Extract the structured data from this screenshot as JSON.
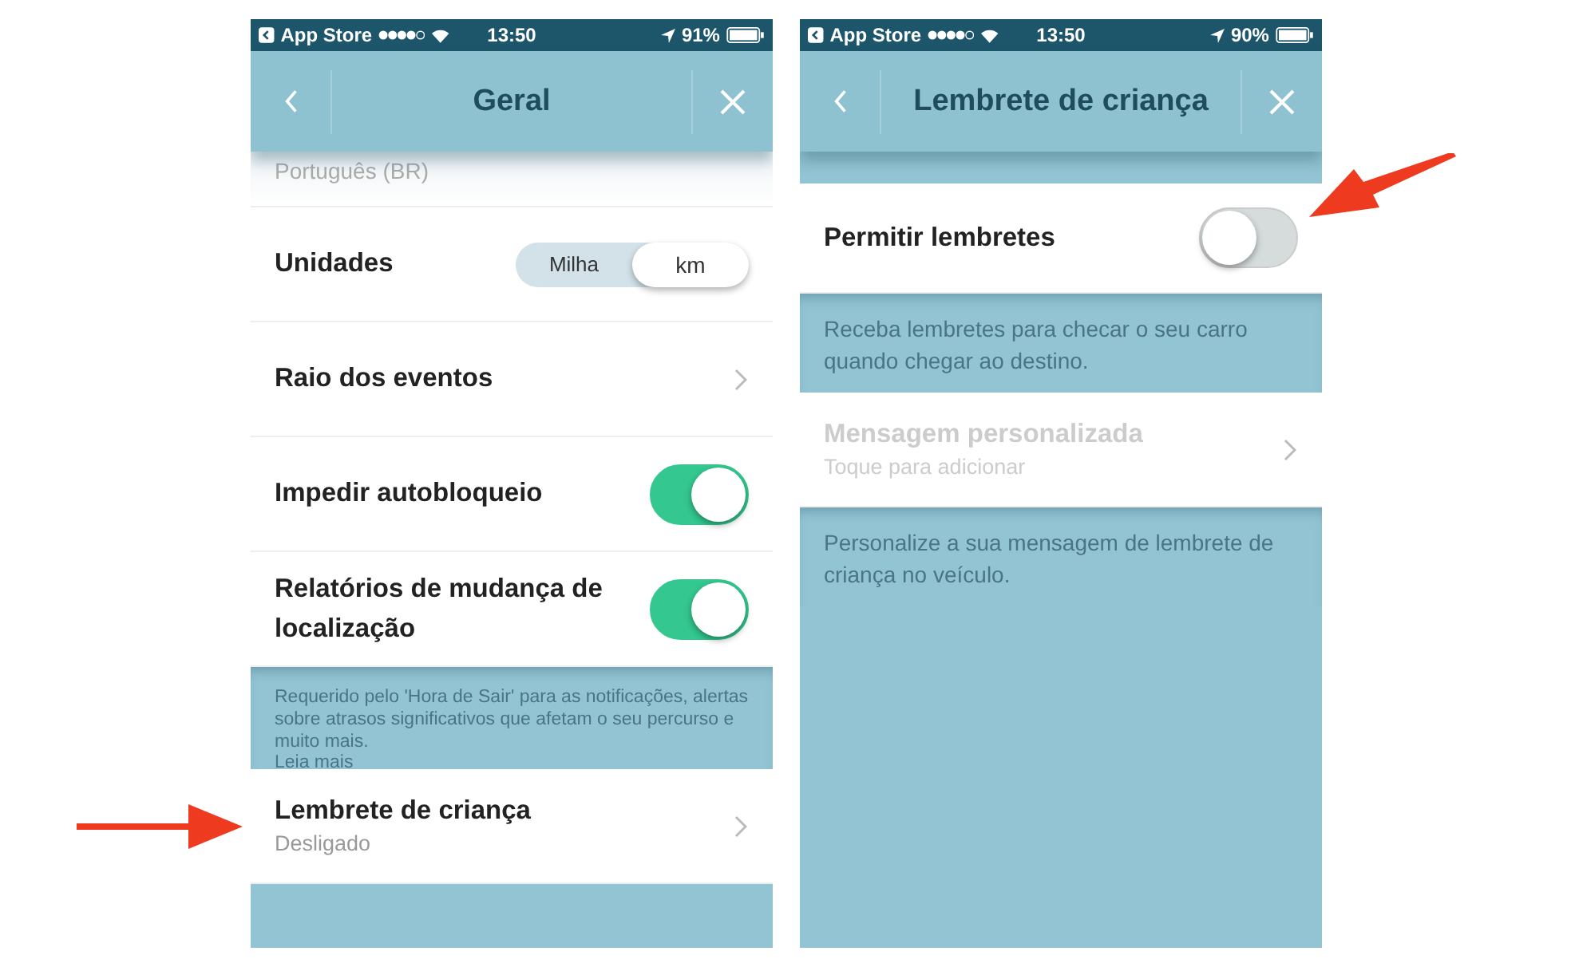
{
  "screens": [
    {
      "status_bar": {
        "back_app": "App Store",
        "time": "13:50",
        "battery": "91%"
      },
      "nav": {
        "title": "Geral"
      },
      "items": [
        {
          "kind": "faded",
          "value": "Português (BR)"
        },
        {
          "kind": "segmented",
          "label": "Unidades",
          "options": [
            {
              "label": "Milha",
              "selected": false
            },
            {
              "label": "km",
              "selected": true
            }
          ]
        },
        {
          "kind": "link",
          "label": "Raio dos eventos",
          "disabled": false
        },
        {
          "kind": "toggle",
          "label": "Impedir autobloqueio",
          "on": true
        },
        {
          "kind": "toggle",
          "label": "Relatórios de mudança de localização",
          "on": true
        },
        {
          "kind": "note",
          "text": "Requerido pelo 'Hora de Sair' para as notificações, alertas sobre atrasos significativos que afetam o seu percurso e muito mais.",
          "link": "Leia mais"
        },
        {
          "kind": "link",
          "label": "Lembrete de criança",
          "subtitle": "Desligado",
          "disabled": false
        }
      ]
    },
    {
      "status_bar": {
        "back_app": "App Store",
        "time": "13:50",
        "battery": "90%"
      },
      "nav": {
        "title": "Lembrete de criança"
      },
      "items": [
        {
          "kind": "toggle",
          "label": "Permitir lembretes",
          "on": false
        },
        {
          "kind": "note",
          "text": "Receba lembretes para checar o seu carro quando chegar ao destino."
        },
        {
          "kind": "link",
          "label": "Mensagem personalizada",
          "subtitle": "Toque para adicionar",
          "disabled": true
        },
        {
          "kind": "note",
          "text": "Personalize a sua mensagem de lembrete de criança no veículo."
        }
      ]
    }
  ]
}
